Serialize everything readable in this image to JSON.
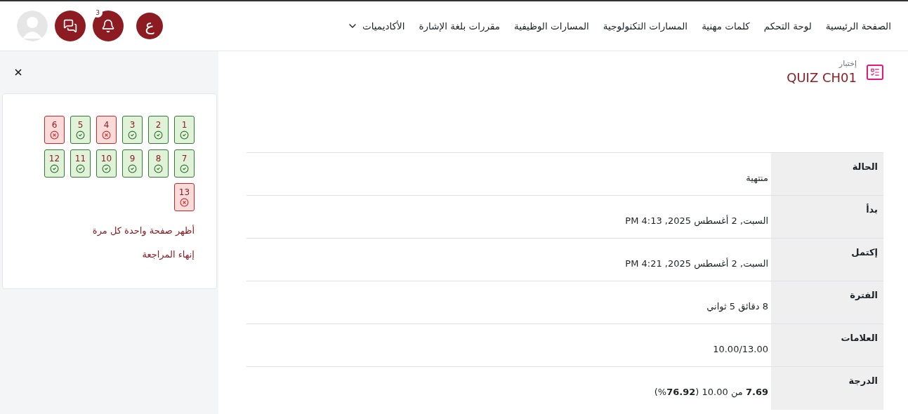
{
  "nav": {
    "items": [
      {
        "label": "الصفحة الرئيسية",
        "dropdown": false
      },
      {
        "label": "لوحة التحكم",
        "dropdown": false
      },
      {
        "label": "كلمات مهنية",
        "dropdown": false
      },
      {
        "label": "المسارات التكنولوجية",
        "dropdown": false
      },
      {
        "label": "المسارات الوظيفية",
        "dropdown": false
      },
      {
        "label": "مقررات بلغة الإشارة",
        "dropdown": false
      },
      {
        "label": "الأكاديميات",
        "dropdown": true
      }
    ],
    "language": "ع",
    "notifications_badge": "3"
  },
  "quiz_navigation": {
    "questions": [
      {
        "number": "1",
        "correct": true
      },
      {
        "number": "2",
        "correct": true
      },
      {
        "number": "3",
        "correct": true
      },
      {
        "number": "4",
        "correct": false
      },
      {
        "number": "5",
        "correct": true
      },
      {
        "number": "6",
        "correct": false
      },
      {
        "number": "7",
        "correct": true
      },
      {
        "number": "8",
        "correct": true
      },
      {
        "number": "9",
        "correct": true
      },
      {
        "number": "10",
        "correct": true
      },
      {
        "number": "11",
        "correct": true
      },
      {
        "number": "12",
        "correct": true
      },
      {
        "number": "13",
        "correct": false
      }
    ],
    "links": [
      "أظهر صفحة واحدة كل مرة",
      "إنهاء المراجعة"
    ]
  },
  "header": {
    "kind_label": "إختبار",
    "title": "QUIZ CH01"
  },
  "summary": {
    "rows": [
      {
        "label": "الحالة",
        "value": "منتهية"
      },
      {
        "label": "بدأ",
        "value": "السبت, 2 أغسطس 2025, 4:13 PM"
      },
      {
        "label": "إكتمل",
        "value": "السبت, 2 أغسطس 2025, 4:21 PM"
      },
      {
        "label": "الفترة",
        "value": "8 دقائق 5 ثواني"
      },
      {
        "label": "العلامات",
        "value": "10.00/13.00"
      },
      {
        "label": "الدرجة",
        "value": "**7.69** من 10.00 (**76.92**%)"
      }
    ]
  }
}
